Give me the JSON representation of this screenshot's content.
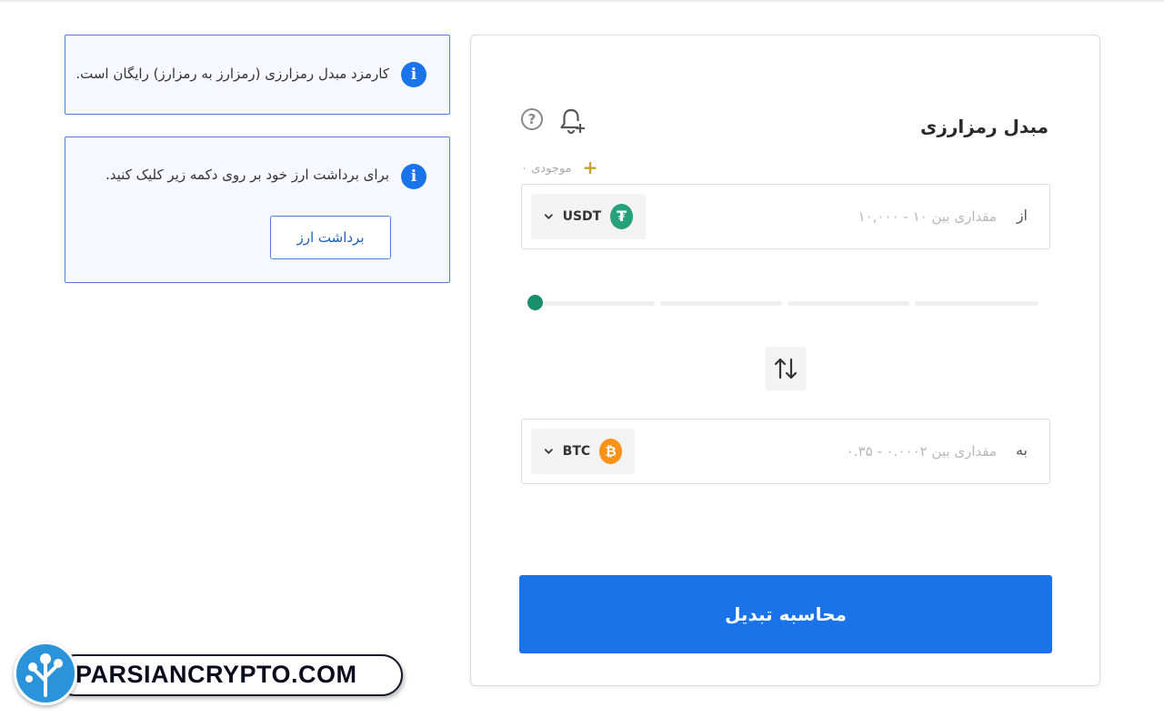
{
  "notices": {
    "fee_text": "کارمزد مبدل رمزارزی (رمزارز به رمزارز) رایگان است.",
    "withdraw_text": "برای برداشت ارز خود بر روی دکمه زیر کلیک کنید.",
    "withdraw_button": "برداشت ارز"
  },
  "converter": {
    "title": "مبدل رمزارزی",
    "balance_label": "موجودی",
    "balance_value": "۰",
    "from": {
      "label": "از",
      "placeholder": "مقداری بین ۱۰ - ۱۰,۰۰۰",
      "coin": "USDT",
      "coin_symbol": "₮",
      "coin_color": "#26a17b"
    },
    "slider": {
      "level": 0,
      "thumb_color": "#1a8f6b"
    },
    "to": {
      "label": "به",
      "placeholder": "مقداری بین ۰.۰۰۰۲ - ۰.۳۵",
      "coin": "BTC",
      "coin_symbol": "₿",
      "coin_color": "#f7931a"
    },
    "calculate_button": "محاسبه تبدیل",
    "accent_color": "#1a73e8"
  },
  "watermark": {
    "text": "PARSIANCRYPTO.COM"
  }
}
